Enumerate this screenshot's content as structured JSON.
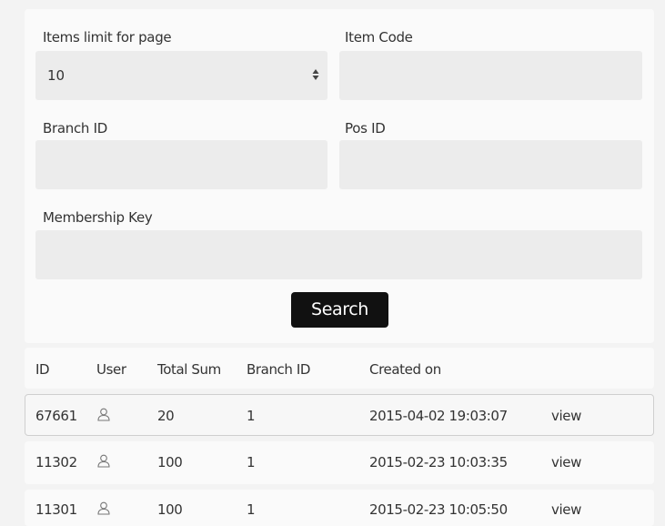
{
  "filters": {
    "items_limit": {
      "label": "Items limit for page",
      "value": "10"
    },
    "item_code": {
      "label": "Item Code",
      "value": ""
    },
    "branch_id": {
      "label": "Branch ID",
      "value": ""
    },
    "pos_id": {
      "label": "Pos ID",
      "value": ""
    },
    "membership_key": {
      "label": "Membership Key",
      "value": ""
    },
    "search_label": "Search"
  },
  "table": {
    "columns": [
      "ID",
      "User",
      "Total Sum",
      "Branch ID",
      "Created on"
    ],
    "rows": [
      {
        "id": "67661",
        "user_icon": "user-icon",
        "total": "20",
        "branch": "1",
        "created": "2015-04-02 19:03:07",
        "action": "view"
      },
      {
        "id": "11302",
        "user_icon": "user-icon",
        "total": "100",
        "branch": "1",
        "created": "2015-02-23 10:03:35",
        "action": "view"
      },
      {
        "id": "11301",
        "user_icon": "user-icon",
        "total": "100",
        "branch": "1",
        "created": "2015-02-23 10:05:50",
        "action": "view"
      }
    ]
  },
  "colors": {
    "button_bg": "#111111",
    "field_bg": "#ececec",
    "panel_bg": "#fafafa"
  }
}
